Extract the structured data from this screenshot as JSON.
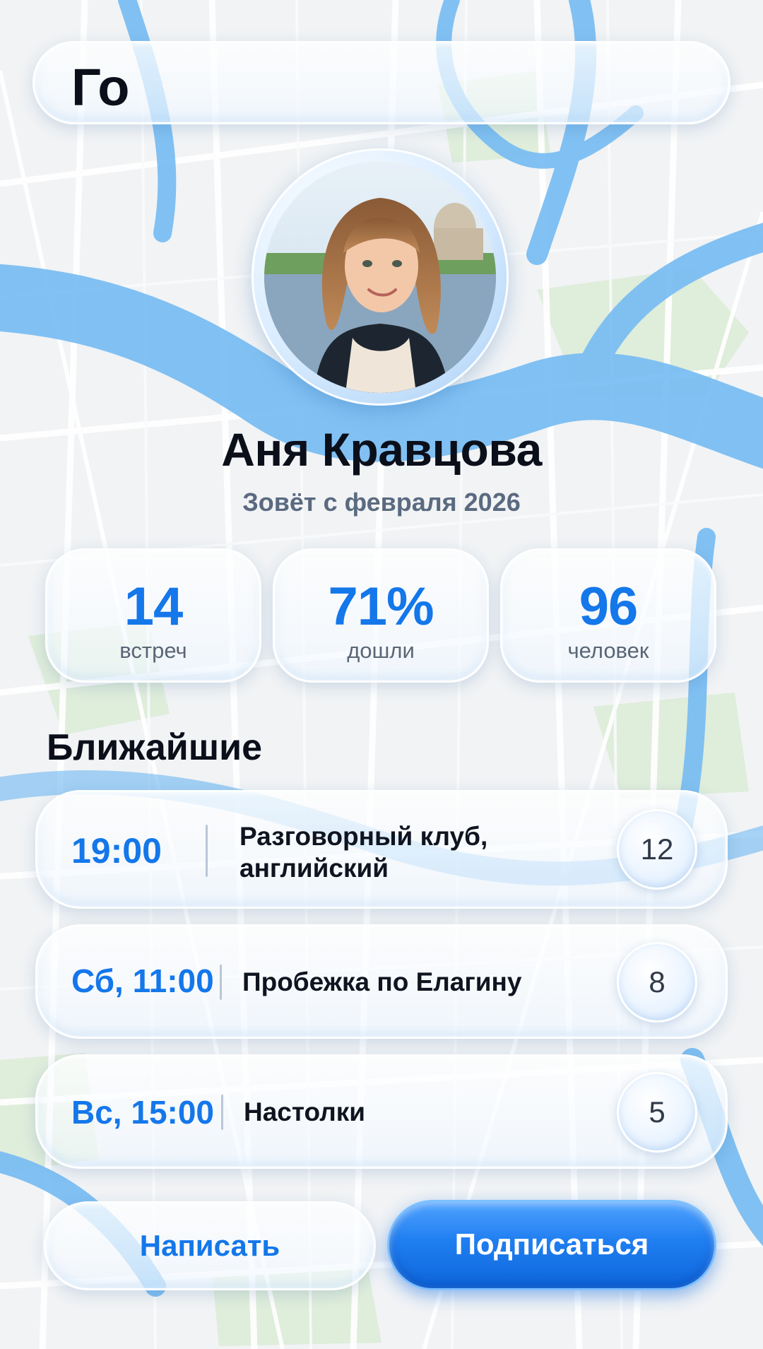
{
  "app": {
    "title": "Го"
  },
  "profile": {
    "name": "Аня Кравцова",
    "since": "Зовёт с февраля 2026"
  },
  "stats": [
    {
      "value": "14",
      "label": "встреч"
    },
    {
      "value": "71%",
      "label": "дошли"
    },
    {
      "value": "96",
      "label": "человек"
    }
  ],
  "upcoming": {
    "title": "Ближайшие",
    "events": [
      {
        "time": "19:00",
        "title_line1": "Разговорный клуб,",
        "title_line2": "английский",
        "count": "12"
      },
      {
        "time": "Сб, 11:00",
        "title_line1": "Пробежка по Елагину",
        "count": "8"
      },
      {
        "time": "Вс, 15:00",
        "title_line1": "Настолки",
        "count": "5"
      }
    ]
  },
  "actions": {
    "message_label": "Написать",
    "subscribe_label": "Подписаться"
  },
  "colors": {
    "accent": "#1477ea",
    "water": "#5aaef0",
    "park": "#cfe6c8",
    "land": "#eef1f3"
  }
}
